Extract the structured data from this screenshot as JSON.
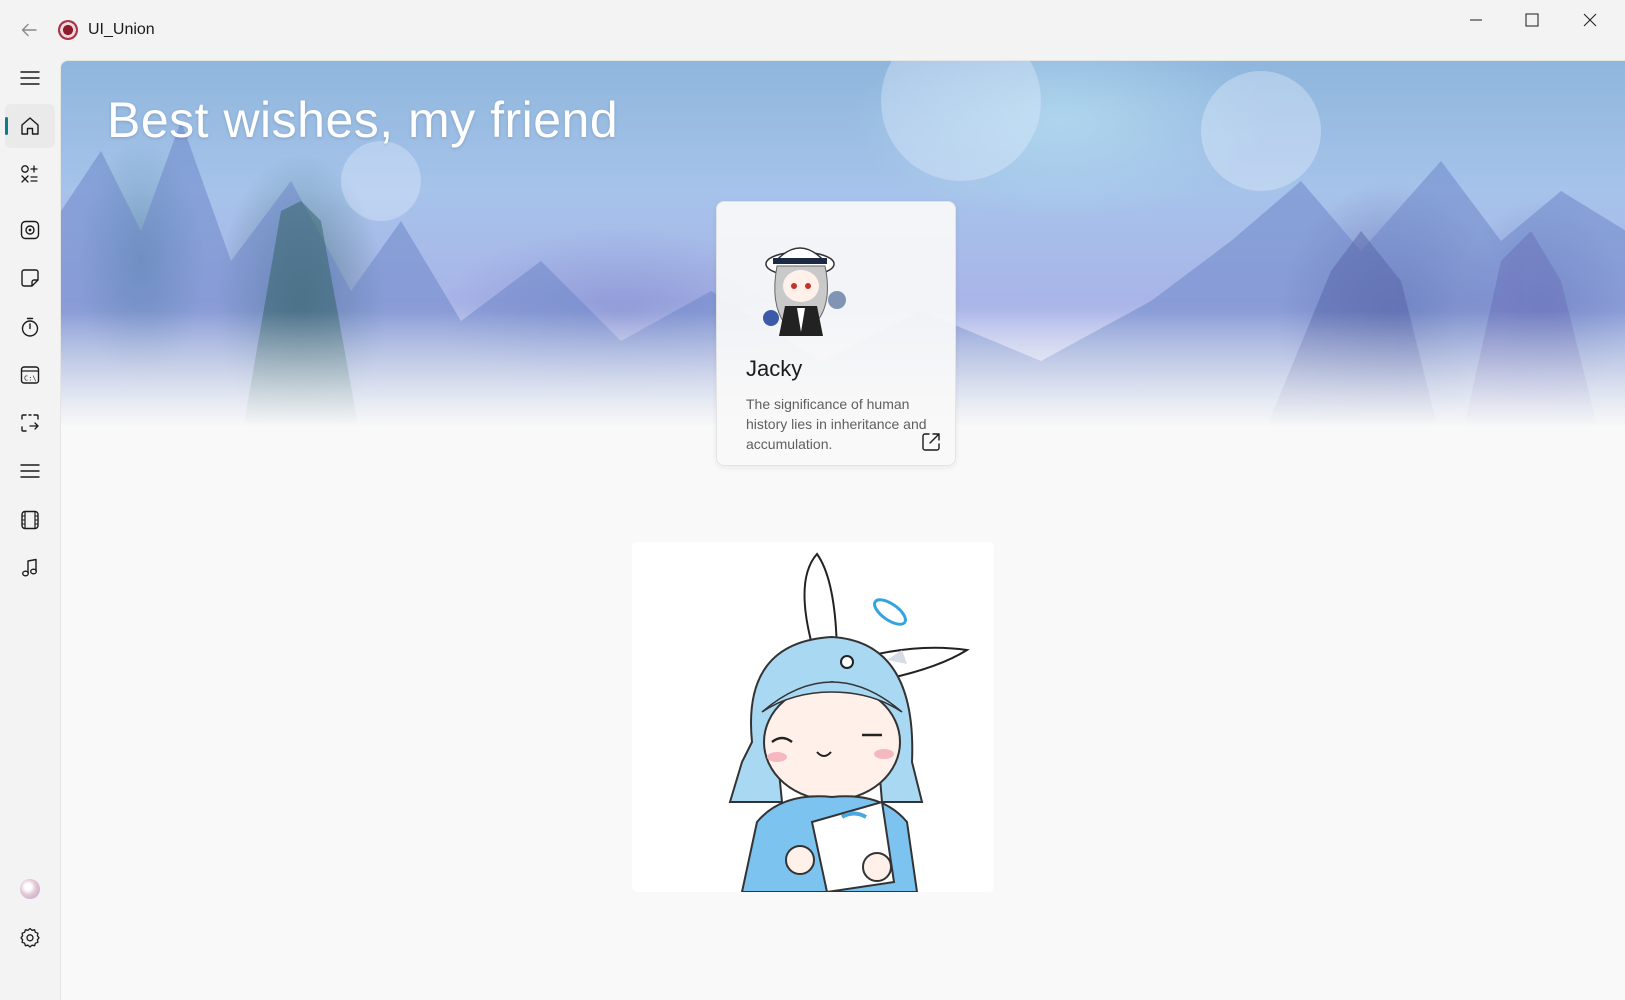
{
  "window": {
    "title": "UI_Union",
    "minimize_label": "Minimize",
    "maximize_label": "Maximize",
    "close_label": "Close"
  },
  "nav": {
    "items": [
      {
        "icon": "menu-icon"
      },
      {
        "icon": "home-icon",
        "selected": true
      },
      {
        "icon": "apps-icon"
      },
      {
        "icon": "camera-icon"
      },
      {
        "icon": "sticky-note-icon"
      },
      {
        "icon": "timer-icon"
      },
      {
        "icon": "terminal-icon"
      },
      {
        "icon": "screen-clip-icon"
      },
      {
        "icon": "list-icon"
      },
      {
        "icon": "film-icon"
      },
      {
        "icon": "music-icon"
      }
    ],
    "footer": [
      {
        "icon": "user-avatar"
      },
      {
        "icon": "settings-icon"
      }
    ]
  },
  "hero": {
    "title": "Best wishes, my friend"
  },
  "profile_card": {
    "name": "Jacky",
    "description": "The significance of human history lies in inheritance and accumulation.",
    "link_icon": "open-external-icon"
  },
  "colors": {
    "accent": "#0f7b8a",
    "background": "#f3f3f3",
    "content_background": "#f9f9f9"
  }
}
